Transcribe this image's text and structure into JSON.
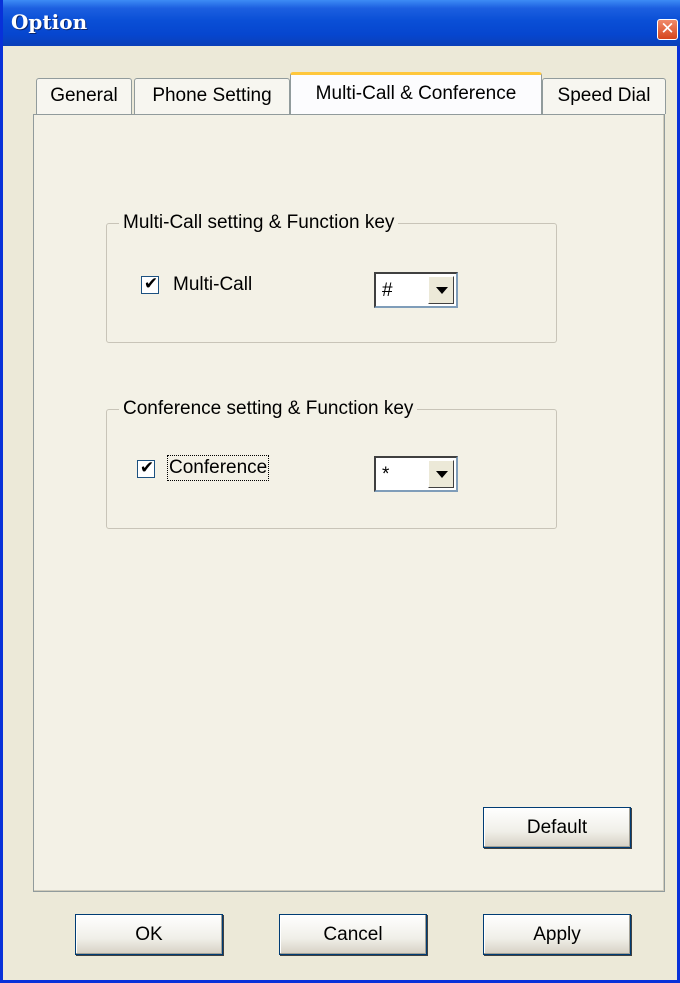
{
  "window": {
    "title": "Option",
    "close_glyph": "✕"
  },
  "tabs": [
    {
      "label": "General",
      "active": false
    },
    {
      "label": "Phone Setting",
      "active": false
    },
    {
      "label": "Multi-Call & Conference",
      "active": true
    },
    {
      "label": "Speed Dial",
      "active": false
    }
  ],
  "multicall_group": {
    "legend": "Multi-Call setting & Function key",
    "checkbox_label": "Multi-Call",
    "checked": true,
    "key_value": "#"
  },
  "conference_group": {
    "legend": "Conference setting & Function key",
    "checkbox_label": "Conference",
    "checked": true,
    "key_value": "*"
  },
  "buttons": {
    "default_label": "Default",
    "ok_label": "OK",
    "cancel_label": "Cancel",
    "apply_label": "Apply"
  },
  "glyphs": {
    "check": "✔"
  },
  "colors": {
    "titlebar": "#0a4fd6",
    "face": "#ece9d8",
    "active_tab_highlight": "#ffc73c"
  },
  "icons": {
    "close": "close-icon",
    "dropdown": "chevron-down-icon",
    "checkmark": "checkmark-icon"
  }
}
